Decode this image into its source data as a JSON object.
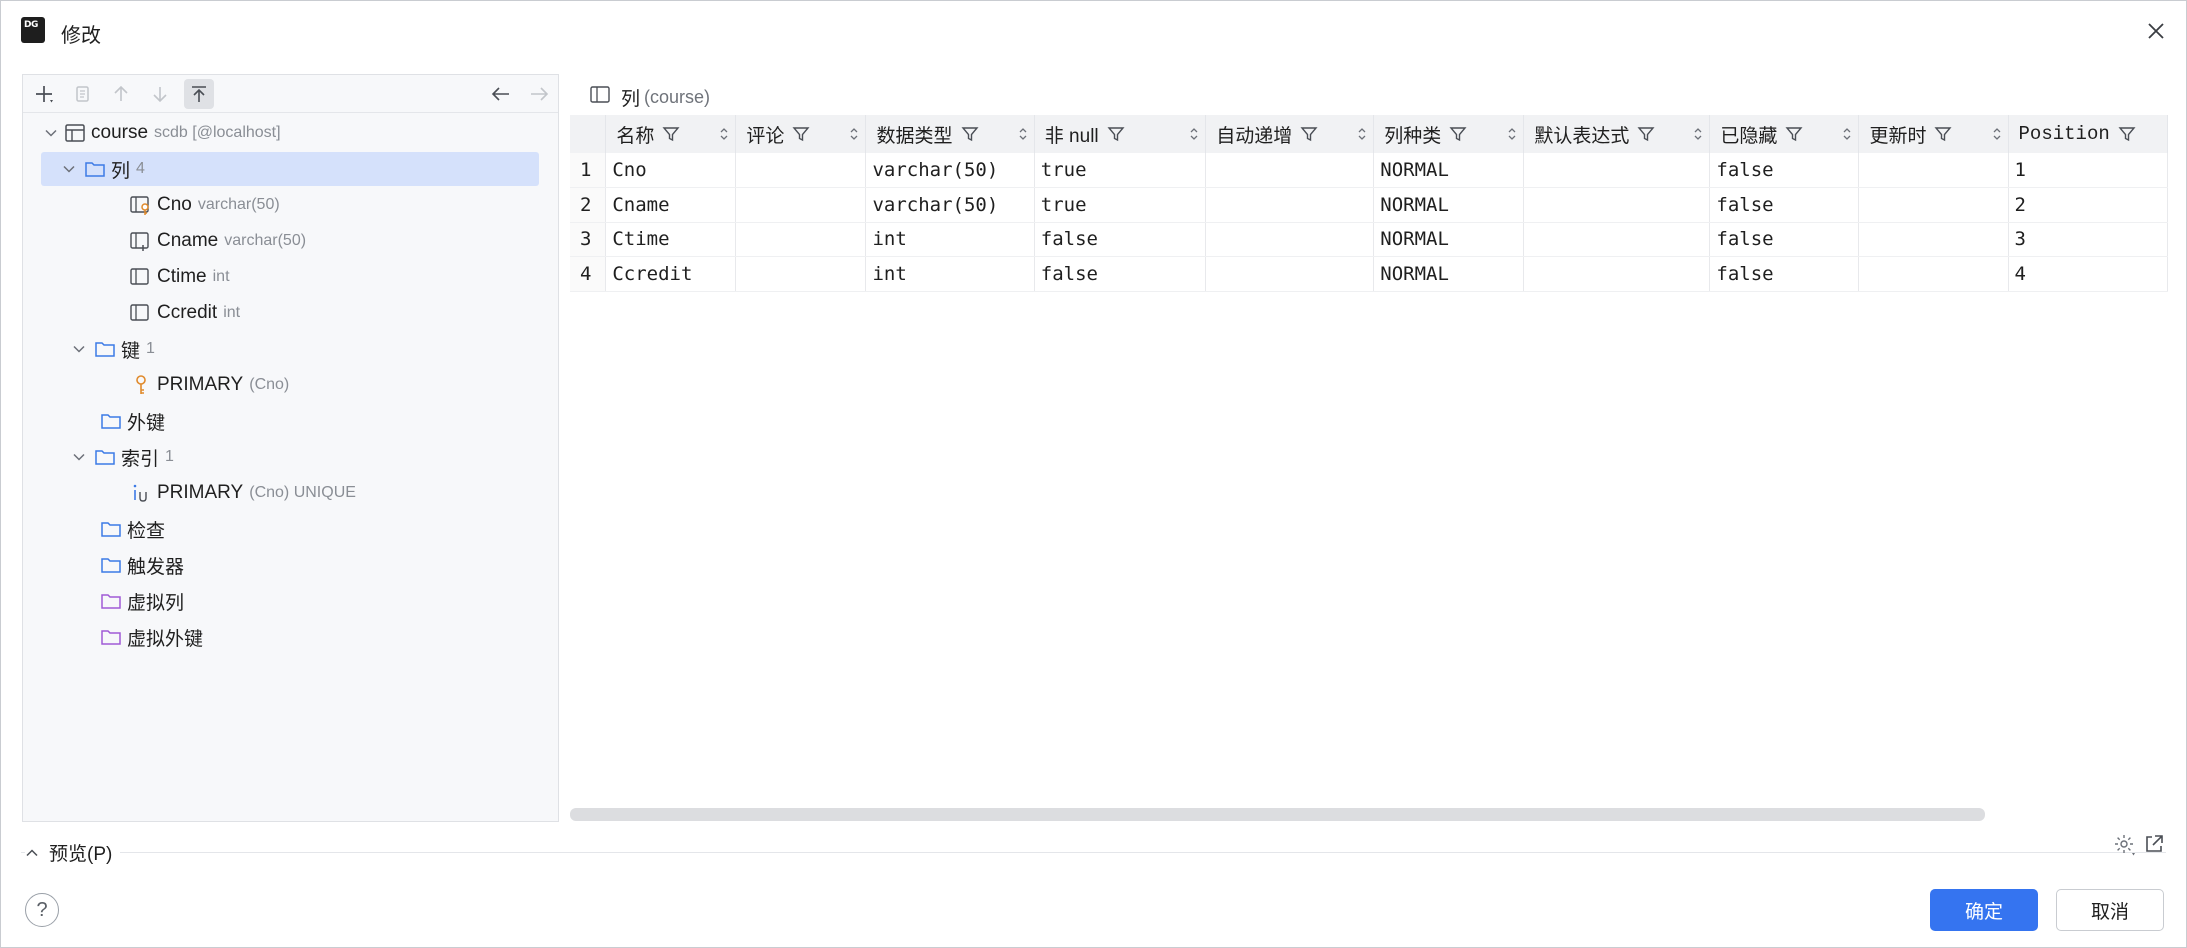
{
  "window": {
    "title": "修改"
  },
  "tree": {
    "root": {
      "label": "course",
      "meta": "scdb [@localhost]"
    },
    "columns_folder": {
      "label": "列",
      "count": "4"
    },
    "columns": [
      {
        "name": "Cno",
        "type": "varchar(50)"
      },
      {
        "name": "Cname",
        "type": "varchar(50)"
      },
      {
        "name": "Ctime",
        "type": "int"
      },
      {
        "name": "Ccredit",
        "type": "int"
      }
    ],
    "keys_folder": {
      "label": "键",
      "count": "1"
    },
    "key": {
      "name": "PRIMARY",
      "meta": "(Cno)"
    },
    "foreign_keys_folder": {
      "label": "外键"
    },
    "indexes_folder": {
      "label": "索引",
      "count": "1"
    },
    "index": {
      "name": "PRIMARY",
      "meta": "(Cno) UNIQUE"
    },
    "checks_folder": {
      "label": "检查"
    },
    "triggers_folder": {
      "label": "触发器"
    },
    "virtual_columns_folder": {
      "label": "虚拟列"
    },
    "virtual_fk_folder": {
      "label": "虚拟外键"
    }
  },
  "right": {
    "header_label": "列",
    "header_meta": "(course)"
  },
  "grid": {
    "headers": [
      "名称",
      "评论",
      "数据类型",
      "非 null",
      "自动递增",
      "列种类",
      "默认表达式",
      "已隐藏",
      "更新时",
      "Position"
    ],
    "rows": [
      [
        "1",
        "Cno",
        "",
        "varchar(50)",
        "true",
        "",
        "NORMAL",
        "",
        "false",
        "",
        "1"
      ],
      [
        "2",
        "Cname",
        "",
        "varchar(50)",
        "true",
        "",
        "NORMAL",
        "",
        "false",
        "",
        "2"
      ],
      [
        "3",
        "Ctime",
        "",
        "int",
        "false",
        "",
        "NORMAL",
        "",
        "false",
        "",
        "3"
      ],
      [
        "4",
        "Ccredit",
        "",
        "int",
        "false",
        "",
        "NORMAL",
        "",
        "false",
        "",
        "4"
      ]
    ]
  },
  "footer": {
    "preview_label": "预览(P)",
    "help_label": "?",
    "ok_label": "确定",
    "cancel_label": "取消"
  },
  "colors": {
    "accent": "#3574f0",
    "selection": "#d5e1fb",
    "folder": "#3c7ae6",
    "virtual_folder": "#a05ad6",
    "key": "#e08a2c"
  }
}
